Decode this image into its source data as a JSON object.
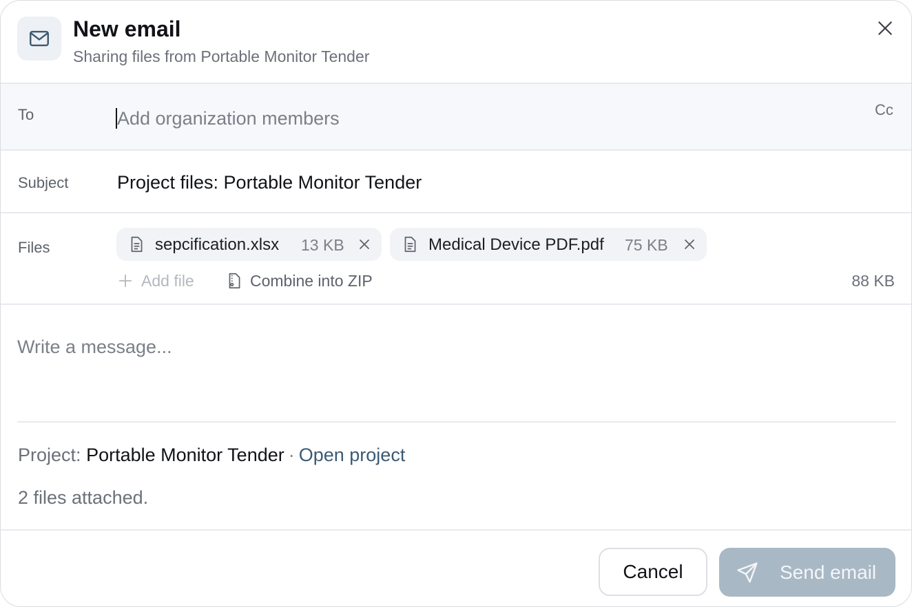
{
  "header": {
    "title": "New email",
    "subtitle": "Sharing files from Portable Monitor Tender",
    "icon": "mail-icon"
  },
  "to": {
    "label": "To",
    "placeholder": "Add organization members",
    "value": "",
    "cc_label": "Cc"
  },
  "subject": {
    "label": "Subject",
    "value": "Project files: Portable Monitor Tender"
  },
  "files": {
    "label": "Files",
    "items": [
      {
        "name": "sepcification.xlsx",
        "size": "13 KB",
        "icon": "file-icon"
      },
      {
        "name": "Medical Device PDF.pdf",
        "size": "75 KB",
        "icon": "file-icon"
      }
    ],
    "add_file_label": "Add file",
    "combine_zip_label": "Combine into ZIP",
    "total_size": "88 KB"
  },
  "message": {
    "placeholder": "Write a message..."
  },
  "project": {
    "prefix": "Project:",
    "name": "Portable Monitor Tender",
    "separator": "·",
    "open_link": "Open project"
  },
  "attached_summary": "2 files attached.",
  "footer": {
    "cancel_label": "Cancel",
    "send_label": "Send email"
  },
  "colors": {
    "accent_link": "#3a5a75",
    "send_button_disabled": "#a9b8c5"
  }
}
